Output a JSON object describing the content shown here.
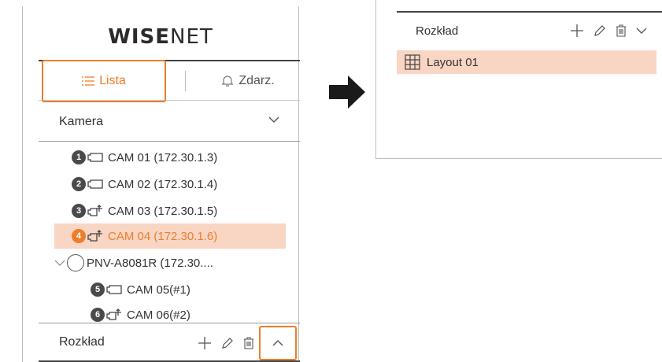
{
  "brand": {
    "logo_bold": "WISE",
    "logo_light": "NET"
  },
  "tabs": [
    {
      "label": "Lista",
      "icon": "list-icon",
      "selected": true
    },
    {
      "label": "Zdarz.",
      "icon": "bell-icon",
      "selected": false
    }
  ],
  "camera_section": {
    "title": "Kamera",
    "icon": "chevron-down-icon"
  },
  "cameras": [
    {
      "num": "1",
      "label": "CAM 01 (172.30.1.3)",
      "icon": "camera-icon",
      "selected": false
    },
    {
      "num": "2",
      "label": "CAM 02 (172.30.1.4)",
      "icon": "camera-icon",
      "selected": false
    },
    {
      "num": "3",
      "label": "CAM 03 (172.30.1.5)",
      "icon": "ptz-camera-icon",
      "selected": false
    },
    {
      "num": "4",
      "label": "CAM 04 (172.30.1.6)",
      "icon": "ptz-camera-icon",
      "selected": true
    }
  ],
  "nvr": {
    "label": "PNV-A8081R (172.30....",
    "icon": "nvr-circle-icon"
  },
  "nvr_channels": [
    {
      "num": "5",
      "label": "CAM 05(#1)",
      "icon": "camera-icon"
    },
    {
      "num": "6",
      "label": "CAM 06(#2)",
      "icon": "ptz-camera-icon"
    }
  ],
  "schedule_section": {
    "title": "Rozkład",
    "tools": [
      "plus-icon",
      "pencil-icon",
      "trash-icon",
      "chevron-up-icon"
    ]
  },
  "right_panel": {
    "title": "Rozkład",
    "tools": [
      "plus-icon",
      "pencil-icon",
      "trash-icon",
      "chevron-down-icon"
    ],
    "layouts": [
      {
        "label": "Layout 01",
        "icon": "grid-layout-icon",
        "selected": true
      }
    ]
  },
  "colors": {
    "accent": "#ee7d2a",
    "selected_bg": "#f9d6c4",
    "badge": "#4a4a4a"
  }
}
